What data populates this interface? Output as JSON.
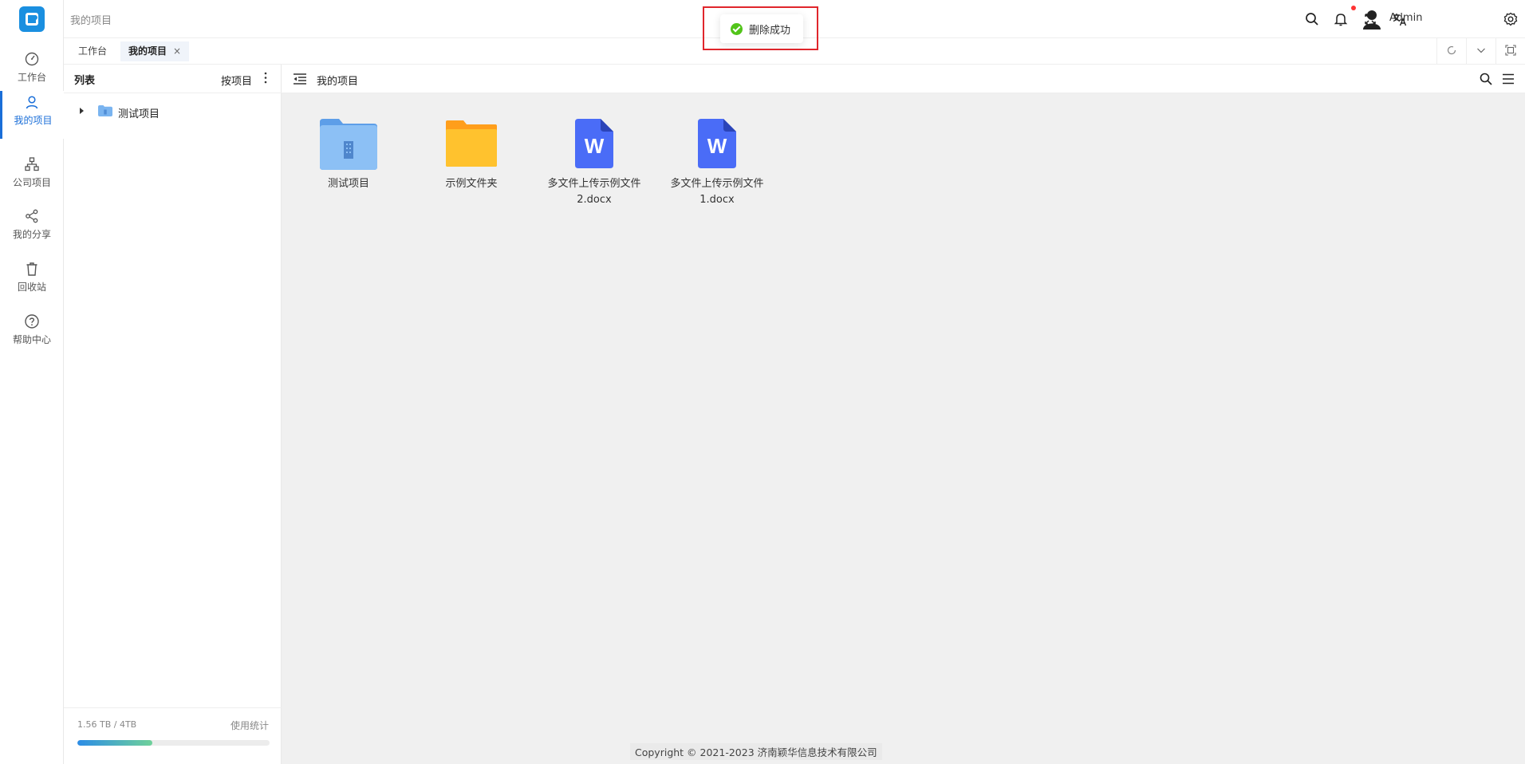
{
  "header": {
    "breadcrumb": "我的项目",
    "user_name": "Admin"
  },
  "nav": {
    "items": [
      {
        "label": "工作台",
        "icon": "dashboard-icon"
      },
      {
        "label": "我的项目",
        "icon": "user-icon"
      },
      {
        "label": "公司项目",
        "icon": "org-icon"
      },
      {
        "label": "我的分享",
        "icon": "share-icon"
      },
      {
        "label": "回收站",
        "icon": "trash-icon"
      },
      {
        "label": "帮助中心",
        "icon": "help-icon"
      }
    ],
    "active": "我的项目"
  },
  "tabs": {
    "items": [
      {
        "label": "工作台"
      },
      {
        "label": "我的项目",
        "close": "×"
      }
    ]
  },
  "tree": {
    "title": "列表",
    "sort_label": "按项目",
    "nodes": [
      {
        "label": "测试项目"
      }
    ]
  },
  "storage": {
    "used_text": "1.56 TB / 4TB",
    "link_label": "使用统计",
    "usage_fraction": 0.39
  },
  "main": {
    "title": "我的项目",
    "files": [
      {
        "name": "测试项目",
        "type": "project-folder"
      },
      {
        "name": "示例文件夹",
        "type": "folder"
      },
      {
        "name": "多文件上传示例文件2.docx",
        "type": "word-doc",
        "icon_letter": "W"
      },
      {
        "name": "多文件上传示例文件1.docx",
        "type": "word-doc",
        "icon_letter": "W"
      }
    ]
  },
  "footer": {
    "copyright": "Copyright © 2021-2023 济南颖华信息技术有限公司"
  },
  "toast": {
    "message": "删除成功"
  },
  "colors": {
    "accent": "#1a6ed8",
    "success": "#52c41a",
    "word_blue": "#4a6cf7",
    "folder_yellow": "#ffc22e",
    "project_folder_blue": "#7ab4f0",
    "highlight_red": "#e0262c"
  }
}
